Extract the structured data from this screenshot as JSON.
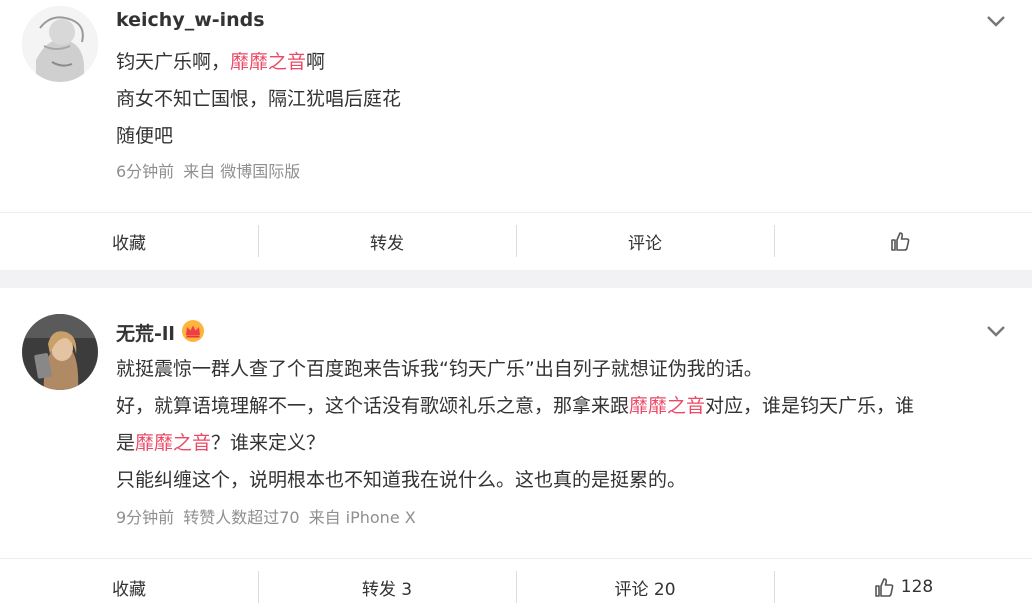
{
  "posts": [
    {
      "username": "keichy_w-inds",
      "lines": [
        {
          "a": "钧天广乐啊，",
          "hl": "靡靡之音",
          "b": "啊"
        },
        {
          "text": "商女不知亡国恨，隔江犹唱后庭花"
        },
        {
          "text": "随便吧"
        }
      ],
      "meta": {
        "time": "6分钟前",
        "source": "来自 微博国际版"
      },
      "actions": {
        "fav": "收藏",
        "repost": "转发",
        "comment": "评论",
        "like": ""
      }
    },
    {
      "username": "无荒-ll",
      "lines": [
        {
          "text": "就挺震惊一群人查了个百度跑来告诉我“钧天广乐”出自列子就想证伪我的话。"
        },
        {
          "a": "好，就算语境理解不一，这个话没有歌颂礼乐之意，那拿来跟",
          "hl": "靡靡之音",
          "b": "对应，谁是钧天广乐，谁"
        },
        {
          "a": "是",
          "hl": "靡靡之音",
          "b": "？谁来定义？"
        },
        {
          "text": "只能纠缠这个，说明根本也不知道我在说什么。这也真的是挺累的。"
        }
      ],
      "meta": {
        "time": "9分钟前",
        "reposts": "转赞人数超过70",
        "source": "来自 iPhone X"
      },
      "actions": {
        "fav": "收藏",
        "repost": "转发 3",
        "comment": "评论 20",
        "like": "128"
      }
    }
  ],
  "colors": {
    "highlight": "#eb4a67",
    "meta": "#8f8f8f",
    "background": "#f2f2f5"
  },
  "icons": [
    "chevron-down-icon",
    "thumbs-up-icon",
    "crown-icon"
  ]
}
